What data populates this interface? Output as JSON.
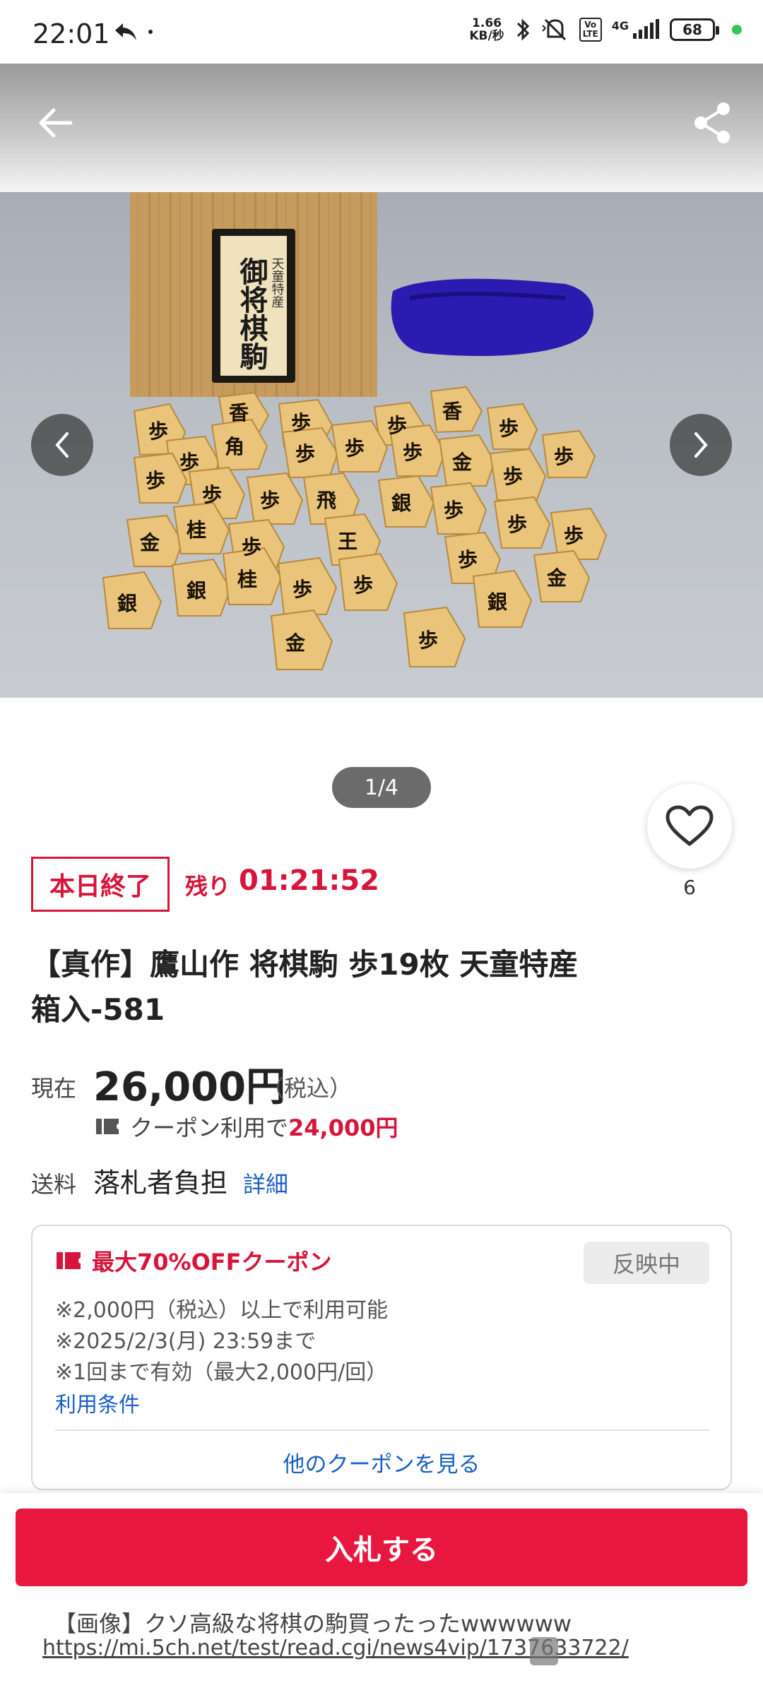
{
  "status_bar": {
    "time": "22:01",
    "net_speed_top": "1.66",
    "net_speed_bottom": "KB/秒",
    "network": "4G",
    "lte": "Vo LTE",
    "battery": "68"
  },
  "header": {
    "back_icon": "arrow-left-icon",
    "share_icon": "share-icon"
  },
  "carousel": {
    "box_label_small": "天童特産",
    "box_label_main": "御将棋駒",
    "pager": "1/4"
  },
  "favorite": {
    "count": "6"
  },
  "auction": {
    "ending_badge": "本日終了",
    "remaining_label": "残り",
    "remaining_time": "01:21:52"
  },
  "item": {
    "title_line1": "【真作】鷹山作 将棋駒 歩19枚 天童特産",
    "title_line2": "箱入-581"
  },
  "price": {
    "label": "現在",
    "value": "26,000円",
    "tax": "（税込）",
    "coupon_text": "クーポン利用で",
    "coupon_price": "24,000円"
  },
  "shipping": {
    "label": "送料",
    "value": "落札者負担",
    "detail_link": "詳細"
  },
  "coupon_card": {
    "title": "最大70%OFFクーポン",
    "reflect_button": "反映中",
    "note1": "※2,000円（税込）以上で利用可能",
    "note2": "※2025/2/3(月) 23:59まで",
    "note3": "※1回まで有効（最大2,000円/回）",
    "terms_link": "利用条件",
    "more_link": "他のクーポンを見る"
  },
  "bottom": {
    "bid_button": "入札する",
    "caption_line1": "【画像】クソ高級な将棋の駒買ったったwwwwww",
    "caption_line2": "https://mi.5ch.net/test/read.cgi/news4vip/1737633722/"
  },
  "colors": {
    "accent_red": "#d7153a",
    "bid_red": "#e8173f",
    "link_blue": "#1a5fc4"
  }
}
